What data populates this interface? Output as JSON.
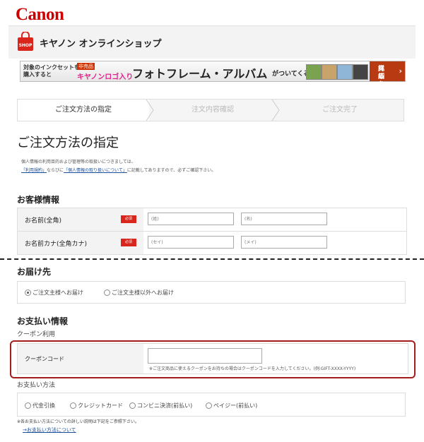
{
  "header": {
    "logo": "Canon",
    "shop_title": "キヤノン オンラインショップ",
    "shop_icon_text": "SHOP"
  },
  "banner": {
    "line1": "対象のインクセットを",
    "line2": "購入すると",
    "tag": "非売品",
    "sub": "キヤノンロゴ入り",
    "main": "フォトフレーム・アルバム",
    "tail": "がついてくる!",
    "more1": "詳細を",
    "more2": "見る"
  },
  "steps": [
    {
      "label": "ご注文方法の指定"
    },
    {
      "label": "注文内容確認"
    },
    {
      "label": "ご注文完了"
    }
  ],
  "page_title": "ご注文方法の指定",
  "notice": {
    "line1": "個人情報の利用目的および管理等の取扱いにつきましては、",
    "link1": "「利用規約」",
    "mid": "ならびに",
    "link2": "「個人情報の取り扱いについて」",
    "tail": "に記載してありますので、必ずご確認下さい。"
  },
  "customer": {
    "heading": "お客様情報",
    "required": "必須",
    "name_label": "お名前(全角)",
    "kana_label": "お名前カナ(全角カナ)",
    "name_last_placeholder": "(姓)",
    "name_first_placeholder": "(名)",
    "kana_last_placeholder": "(セイ)",
    "kana_first_placeholder": "(メイ)"
  },
  "delivery": {
    "heading": "お届け先",
    "opt1": "ご注文主様へお届け",
    "opt2": "ご注文主様以外へお届け"
  },
  "payment": {
    "heading": "お支払い情報",
    "coupon_sub": "クーポン利用",
    "coupon_label": "クーポンコード",
    "coupon_hint": "※ご注文商品に使えるクーポンをお持ちの場合はクーポンコードを入力してください。(例:GIFT-XXXX-YYYY)",
    "method_sub": "お支払い方法",
    "methods": [
      "代金引換",
      "クレジットカード",
      "コンビニ決済(前払い)",
      "ペイジー(前払い)"
    ],
    "note": "※各お支払い方法についての詳しい説明は下記をご参照下さい。",
    "link": "→お支払い方法について"
  },
  "colors": {
    "brand": "#cc0000",
    "required": "#d9251c",
    "highlight": "#a31c1c",
    "link": "#1a4fa0"
  }
}
